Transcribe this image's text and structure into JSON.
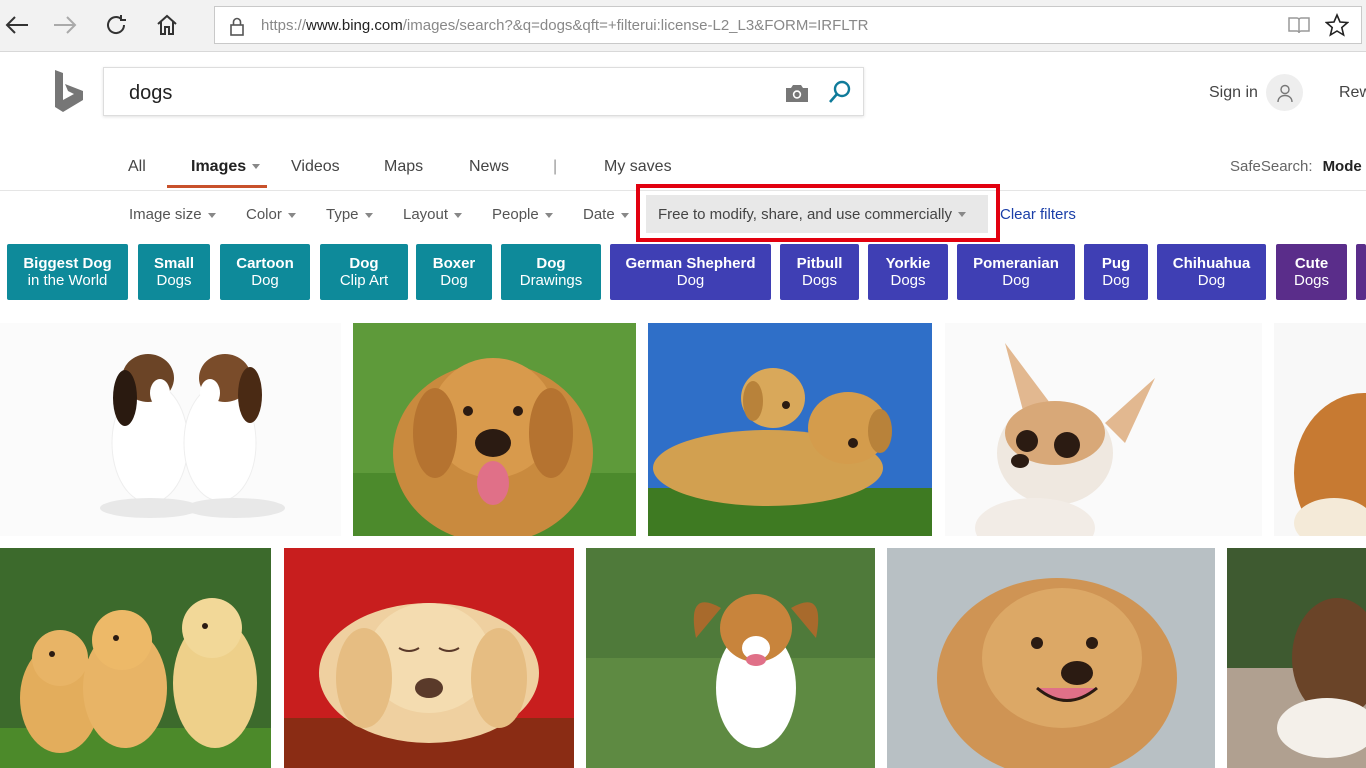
{
  "browser": {
    "url_prefix": "https://",
    "url_domain": "www.bing.com",
    "url_rest": "/images/search?&q=dogs&qft=+filterui:license-L2_L3&FORM=IRFLTR"
  },
  "header": {
    "query": "dogs",
    "sign_in": "Sign in",
    "rewards": "Rew"
  },
  "scopes": [
    {
      "label": "All"
    },
    {
      "label": "Images"
    },
    {
      "label": "Videos"
    },
    {
      "label": "Maps"
    },
    {
      "label": "News"
    },
    {
      "label": "|"
    },
    {
      "label": "My saves"
    }
  ],
  "safesearch": {
    "label": "SafeSearch:",
    "value": "Mode"
  },
  "filters": [
    {
      "label": "Image size"
    },
    {
      "label": "Color"
    },
    {
      "label": "Type"
    },
    {
      "label": "Layout"
    },
    {
      "label": "People"
    },
    {
      "label": "Date"
    }
  ],
  "license_filter": "Free to modify, share, and use commercially",
  "clear_filters": "Clear filters",
  "chips": [
    {
      "l1": "Biggest Dog",
      "l2": "in the World",
      "color": "#0e8a9a"
    },
    {
      "l1": "Small",
      "l2": "Dogs",
      "color": "#0e8a9a"
    },
    {
      "l1": "Cartoon",
      "l2": "Dog",
      "color": "#0e8a9a"
    },
    {
      "l1": "Dog",
      "l2": "Clip Art",
      "color": "#0e8a9a"
    },
    {
      "l1": "Boxer",
      "l2": "Dog",
      "color": "#0e8a9a"
    },
    {
      "l1": "Dog",
      "l2": "Drawings",
      "color": "#0e8a9a"
    },
    {
      "l1": "German Shepherd",
      "l2": "Dog",
      "color": "#3f3fb4"
    },
    {
      "l1": "Pitbull",
      "l2": "Dogs",
      "color": "#3f3fb4"
    },
    {
      "l1": "Yorkie",
      "l2": "Dogs",
      "color": "#3f3fb4"
    },
    {
      "l1": "Pomeranian",
      "l2": "Dog",
      "color": "#3f3fb4"
    },
    {
      "l1": "Pug",
      "l2": "Dog",
      "color": "#3f3fb4"
    },
    {
      "l1": "Chihuahua",
      "l2": "Dog",
      "color": "#3f3fb4"
    },
    {
      "l1": "Cute",
      "l2": "Dogs",
      "color": "#5a2d8a"
    }
  ],
  "colors": {
    "accent_underline": "#c8512b",
    "highlight_box": "#e2000f",
    "link_blue": "#1a3ea8"
  }
}
